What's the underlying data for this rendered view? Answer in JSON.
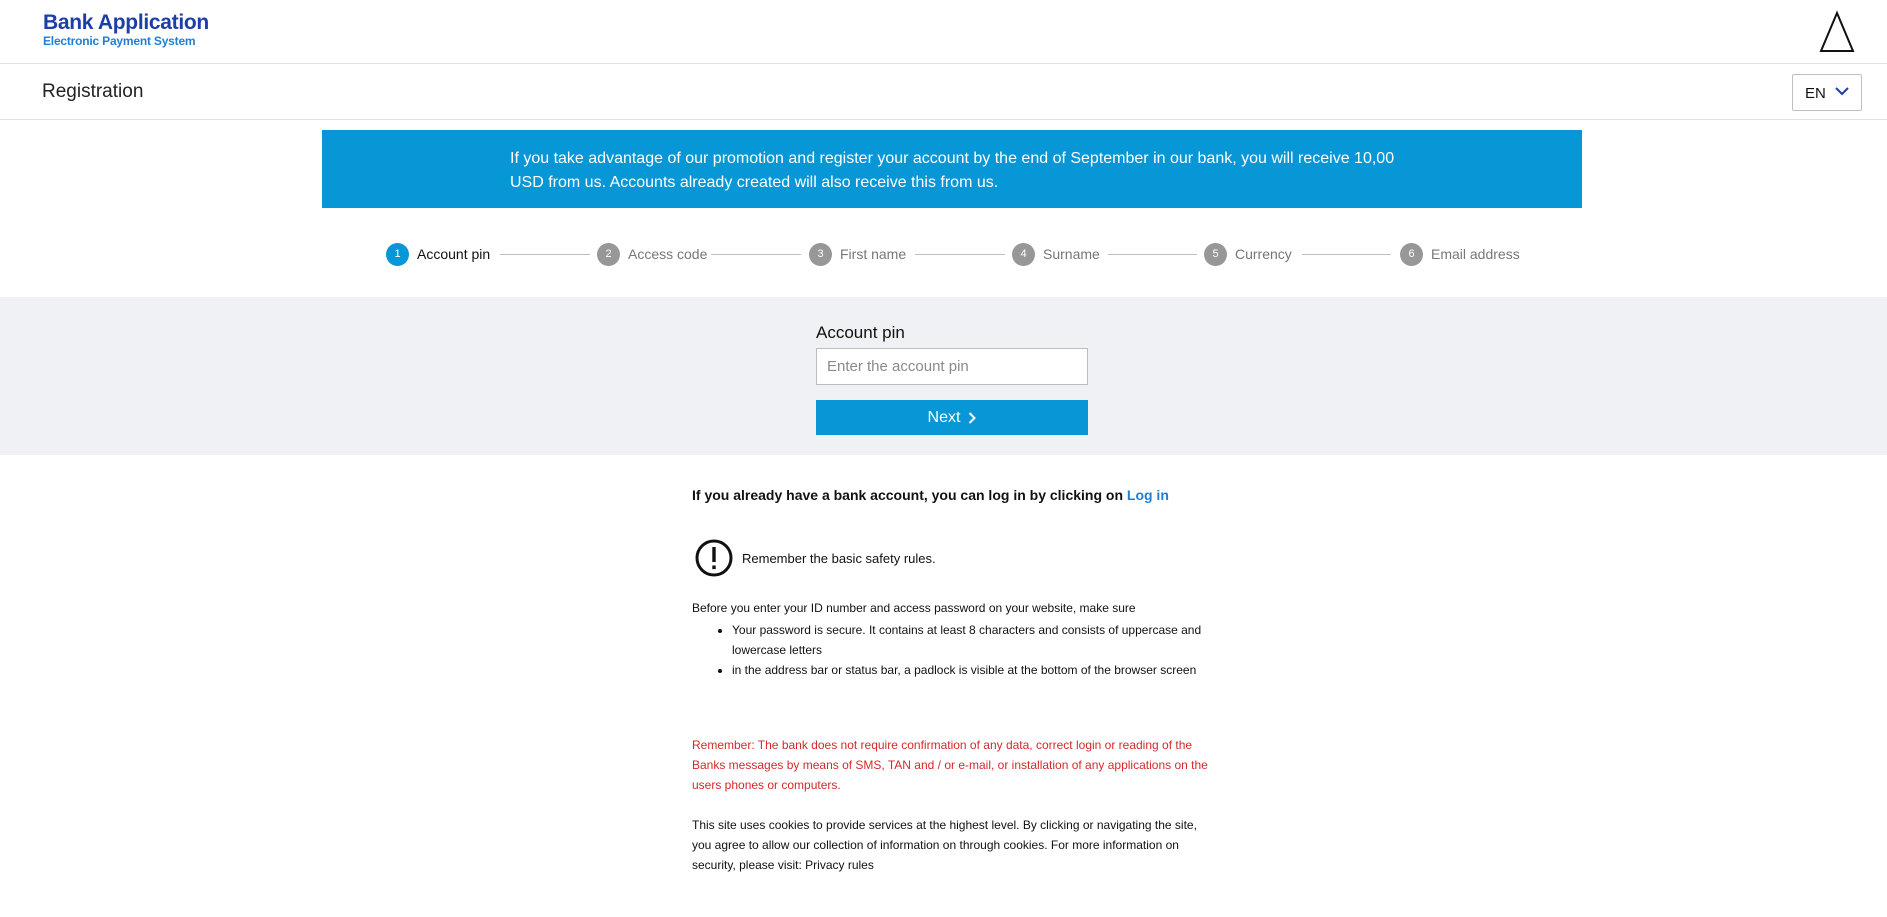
{
  "header": {
    "brand_title": "Bank Application",
    "brand_subtitle": "Electronic Payment System",
    "logo_icon": "triangle-logo-icon"
  },
  "page": {
    "title": "Registration",
    "language": "EN"
  },
  "promo": {
    "text": "If you take advantage of our promotion and register your account by the end of September in our bank, you will receive 10,00 USD from us. Accounts already created will also receive this from us."
  },
  "steps": [
    {
      "number": "1",
      "label": "Account pin",
      "active": true
    },
    {
      "number": "2",
      "label": "Access code",
      "active": false
    },
    {
      "number": "3",
      "label": "First name",
      "active": false
    },
    {
      "number": "4",
      "label": "Surname",
      "active": false
    },
    {
      "number": "5",
      "label": "Currency",
      "active": false
    },
    {
      "number": "6",
      "label": "Email address",
      "active": false
    }
  ],
  "form": {
    "label": "Account pin",
    "placeholder": "Enter the account pin",
    "value": "",
    "next_label": "Next"
  },
  "info": {
    "login_prefix": "If you already have a bank account, you can log in by clicking on",
    "login_link": "Log in",
    "safety_text": "Remember the basic safety rules.",
    "before_text": "Before you enter your ID number and access password on your website, make sure",
    "rules": [
      "Your password is secure. It contains at least 8 characters and consists of uppercase and lowercase letters",
      "in the address bar or status bar, a padlock is visible at the bottom of the browser screen"
    ],
    "warning": "Remember: The bank does not require confirmation of any data, correct login or reading of the Banks messages by means of SMS, TAN and / or e-mail, or installation of any applications on the users phones or computers.",
    "cookies": "This site uses cookies to provide services at the highest level. By clicking or navigating the site, you agree to allow our collection of information on through cookies. For more information on security, please visit: Privacy rules"
  },
  "colors": {
    "accent": "#0897d6",
    "brand": "#1b3ea8",
    "warning": "#d42a2a",
    "inactive_step": "#979797"
  }
}
